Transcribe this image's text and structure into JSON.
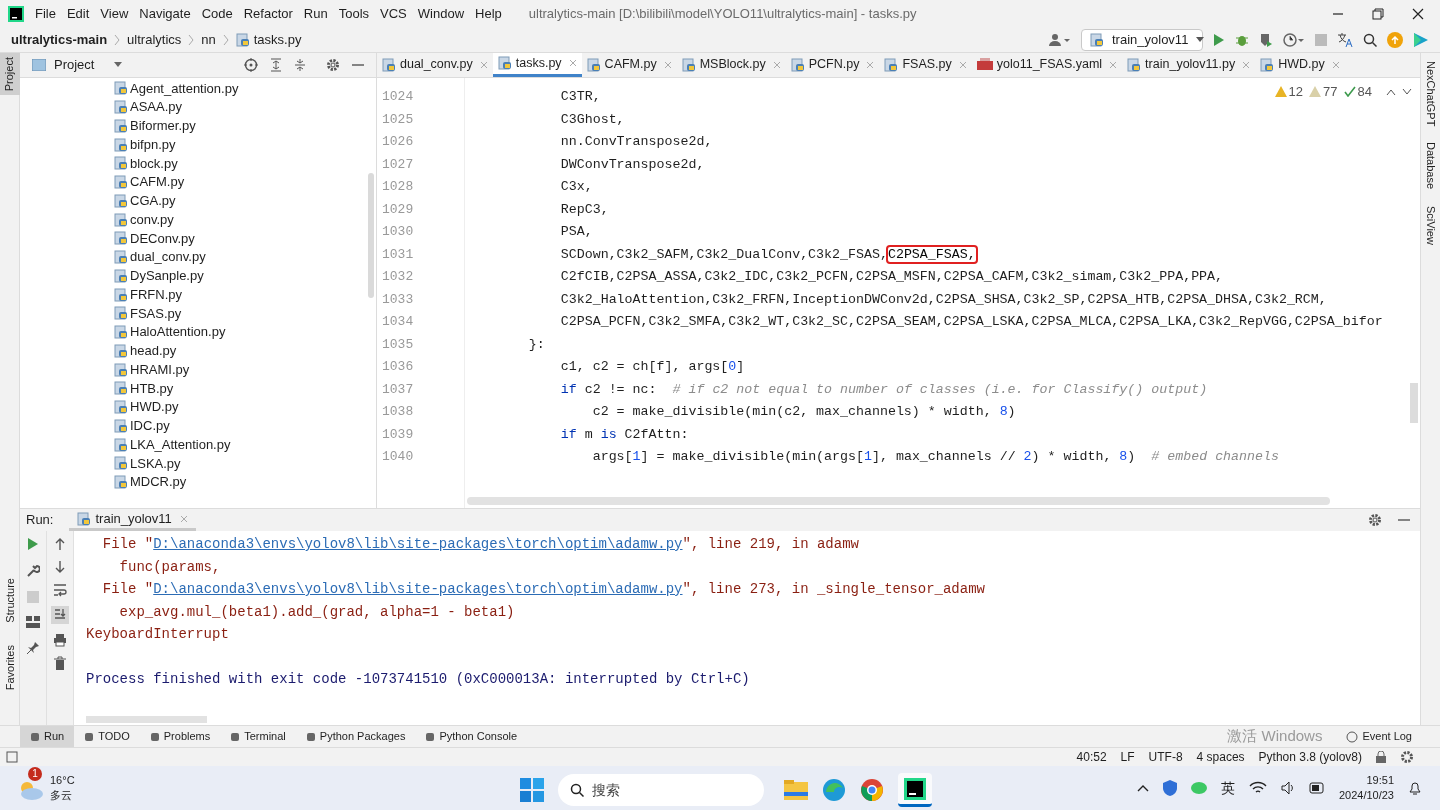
{
  "window": {
    "title": "ultralytics-main [D:\\bilibili\\model\\YOLO11\\ultralytics-main] - tasks.py"
  },
  "menu": [
    "File",
    "Edit",
    "View",
    "Navigate",
    "Code",
    "Refactor",
    "Run",
    "Tools",
    "VCS",
    "Window",
    "Help"
  ],
  "breadcrumb": [
    "ultralytics-main",
    "ultralytics",
    "nn",
    "tasks.py"
  ],
  "run_config": "train_yolov11",
  "project_panel": {
    "title": "Project",
    "files": [
      {
        "name": "Agent_attention.py"
      },
      {
        "name": "ASAA.py"
      },
      {
        "name": "Biformer.py"
      },
      {
        "name": "bifpn.py"
      },
      {
        "name": "block.py"
      },
      {
        "name": "CAFM.py"
      },
      {
        "name": "CGA.py"
      },
      {
        "name": "conv.py"
      },
      {
        "name": "DEConv.py"
      },
      {
        "name": "dual_conv.py"
      },
      {
        "name": "DySanple.py"
      },
      {
        "name": "FRFN.py"
      },
      {
        "name": "FSAS.py"
      },
      {
        "name": "HaloAttention.py"
      },
      {
        "name": "head.py"
      },
      {
        "name": "HRAMI.py"
      },
      {
        "name": "HTB.py"
      },
      {
        "name": "HWD.py"
      },
      {
        "name": "IDC.py"
      },
      {
        "name": "LKA_Attention.py"
      },
      {
        "name": "LSKA.py"
      },
      {
        "name": "MDCR.py"
      }
    ]
  },
  "editor_tabs": [
    {
      "label": "dual_conv.py",
      "kind": "python",
      "selected": false
    },
    {
      "label": "tasks.py",
      "kind": "python",
      "selected": true
    },
    {
      "label": "CAFM.py",
      "kind": "python",
      "selected": false
    },
    {
      "label": "MSBlock.py",
      "kind": "python",
      "selected": false
    },
    {
      "label": "PCFN.py",
      "kind": "python",
      "selected": false
    },
    {
      "label": "FSAS.py",
      "kind": "python",
      "selected": false
    },
    {
      "label": "yolo11_FSAS.yaml",
      "kind": "yaml",
      "selected": false
    },
    {
      "label": "train_yolov11.py",
      "kind": "python",
      "selected": false
    },
    {
      "label": "HWD.py",
      "kind": "python",
      "selected": false
    }
  ],
  "inspections": {
    "warnings": "12",
    "weak_warnings": "77",
    "typos": "84"
  },
  "code_lines": [
    {
      "number": "1024",
      "tokens": [
        {
          "kind": "plain",
          "text": "            C3TR,"
        }
      ]
    },
    {
      "number": "1025",
      "tokens": [
        {
          "kind": "plain",
          "text": "            C3Ghost,"
        }
      ]
    },
    {
      "number": "1026",
      "tokens": [
        {
          "kind": "plain",
          "text": "            nn.ConvTranspose2d,"
        }
      ]
    },
    {
      "number": "1027",
      "tokens": [
        {
          "kind": "plain",
          "text": "            DWConvTranspose2d,"
        }
      ]
    },
    {
      "number": "1028",
      "tokens": [
        {
          "kind": "plain",
          "text": "            C3x,"
        }
      ]
    },
    {
      "number": "1029",
      "tokens": [
        {
          "kind": "plain",
          "text": "            RepC3,"
        }
      ]
    },
    {
      "number": "1030",
      "tokens": [
        {
          "kind": "plain",
          "text": "            PSA,"
        }
      ]
    },
    {
      "number": "1031",
      "tokens": [
        {
          "kind": "plain",
          "text": "            SCDown,C3k2_SAFM,C3k2_DualConv,C3k2_FSAS,"
        },
        {
          "kind": "boxed",
          "text": "C2PSA_FSAS,"
        }
      ]
    },
    {
      "number": "1032",
      "tokens": [
        {
          "kind": "plain",
          "text": "            C2fCIB,C2PSA_ASSA,C3k2_IDC,C3k2_PCFN,C2PSA_MSFN,C2PSA_CAFM,C3k2_simam,C3k2_PPA,PPA,"
        }
      ]
    },
    {
      "number": "1033",
      "tokens": [
        {
          "kind": "plain",
          "text": "            C3k2_HaloAttention,C3k2_FRFN,InceptionDWConv2d,C2PSA_SHSA,C3k2_SP,C2PSA_HTB,C2PSA_DHSA,C3k2_RCM,"
        }
      ]
    },
    {
      "number": "1034",
      "tokens": [
        {
          "kind": "plain",
          "text": "            C2PSA_PCFN,C3k2_SMFA,C3k2_WT,C3k2_SC,C2PSA_SEAM,C2PSA_LSKA,C2PSA_MLCA,C2PSA_LKA,C3k2_RepVGG,C2PSA_bifor"
        }
      ]
    },
    {
      "number": "1035",
      "tokens": [
        {
          "kind": "plain",
          "text": "        }:"
        }
      ]
    },
    {
      "number": "1036",
      "tokens": [
        {
          "kind": "plain",
          "text": "            c1, c2 = ch[f], args["
        },
        {
          "kind": "number",
          "text": "0"
        },
        {
          "kind": "plain",
          "text": "]"
        }
      ]
    },
    {
      "number": "1037",
      "tokens": [
        {
          "kind": "keyword",
          "text": "            if"
        },
        {
          "kind": "plain",
          "text": " c2 != nc:  "
        },
        {
          "kind": "comment",
          "text": "# if c2 not equal to number of classes (i.e. for Classify() output)"
        }
      ]
    },
    {
      "number": "1038",
      "tokens": [
        {
          "kind": "plain",
          "text": "                c2 = make_divisible(min(c2, max_channels) * width, "
        },
        {
          "kind": "number",
          "text": "8"
        },
        {
          "kind": "plain",
          "text": ")"
        }
      ]
    },
    {
      "number": "1039",
      "tokens": [
        {
          "kind": "keyword",
          "text": "            if"
        },
        {
          "kind": "plain",
          "text": " m "
        },
        {
          "kind": "keyword",
          "text": "is"
        },
        {
          "kind": "plain",
          "text": " C2fAttn:"
        }
      ]
    },
    {
      "number": "1040",
      "tokens": [
        {
          "kind": "plain",
          "text": "                args["
        },
        {
          "kind": "number",
          "text": "1"
        },
        {
          "kind": "plain",
          "text": "] = make_divisible(min(args["
        },
        {
          "kind": "number",
          "text": "1"
        },
        {
          "kind": "plain",
          "text": "], max_channels // "
        },
        {
          "kind": "number",
          "text": "2"
        },
        {
          "kind": "plain",
          "text": ") * width, "
        },
        {
          "kind": "number",
          "text": "8"
        },
        {
          "kind": "plain",
          "text": ")  "
        },
        {
          "kind": "comment",
          "text": "# embed channels"
        }
      ]
    }
  ],
  "right_tools": [
    "NexChatGPT",
    "Database",
    "SciView"
  ],
  "left_tools": [
    "Structure",
    "Favorites"
  ],
  "project_tool": "Project",
  "run_panel": {
    "label": "Run:",
    "tab": "train_yolov11",
    "lines": [
      {
        "kind": "trace",
        "parts": [
          {
            "kind": "text",
            "text": "  File \""
          },
          {
            "kind": "link",
            "text": "D:\\anaconda3\\envs\\yolov8\\lib\\site-packages\\torch\\optim\\adamw.py"
          },
          {
            "kind": "text",
            "text": "\", line 219, in adamw"
          }
        ]
      },
      {
        "kind": "trace",
        "parts": [
          {
            "kind": "text",
            "text": "    func(params,"
          }
        ]
      },
      {
        "kind": "trace",
        "parts": [
          {
            "kind": "text",
            "text": "  File \""
          },
          {
            "kind": "link",
            "text": "D:\\anaconda3\\envs\\yolov8\\lib\\site-packages\\torch\\optim\\adamw.py"
          },
          {
            "kind": "text",
            "text": "\", line 273, in _single_tensor_adamw"
          }
        ]
      },
      {
        "kind": "trace",
        "parts": [
          {
            "kind": "text",
            "text": "    exp_avg.mul_(beta1).add_(grad, alpha=1 - beta1)"
          }
        ]
      },
      {
        "kind": "trace",
        "parts": [
          {
            "kind": "text",
            "text": "KeyboardInterrupt"
          }
        ]
      },
      {
        "kind": "blank"
      },
      {
        "kind": "info",
        "parts": [
          {
            "kind": "text",
            "text": "Process finished with exit code -1073741510 (0xC000013A: interrupted by Ctrl+C)"
          }
        ]
      }
    ]
  },
  "bottom_tabs": [
    {
      "label": "Run",
      "selected": true
    },
    {
      "label": "TODO",
      "selected": false
    },
    {
      "label": "Problems",
      "selected": false
    },
    {
      "label": "Terminal",
      "selected": false
    },
    {
      "label": "Python Packages",
      "selected": false
    },
    {
      "label": "Python Console",
      "selected": false
    }
  ],
  "event_log": "Event Log",
  "activation_notice": "激活 Windows",
  "status_bar": [
    "40:52",
    "LF",
    "UTF-8",
    "4 spaces",
    "Python 3.8 (yolov8)"
  ],
  "taskbar": {
    "weather_badge": "1",
    "temperature": "16°C",
    "weather": "多云",
    "search_placeholder": "搜索",
    "input_method": "英",
    "time": "19:51",
    "date": "2024/10/23"
  }
}
